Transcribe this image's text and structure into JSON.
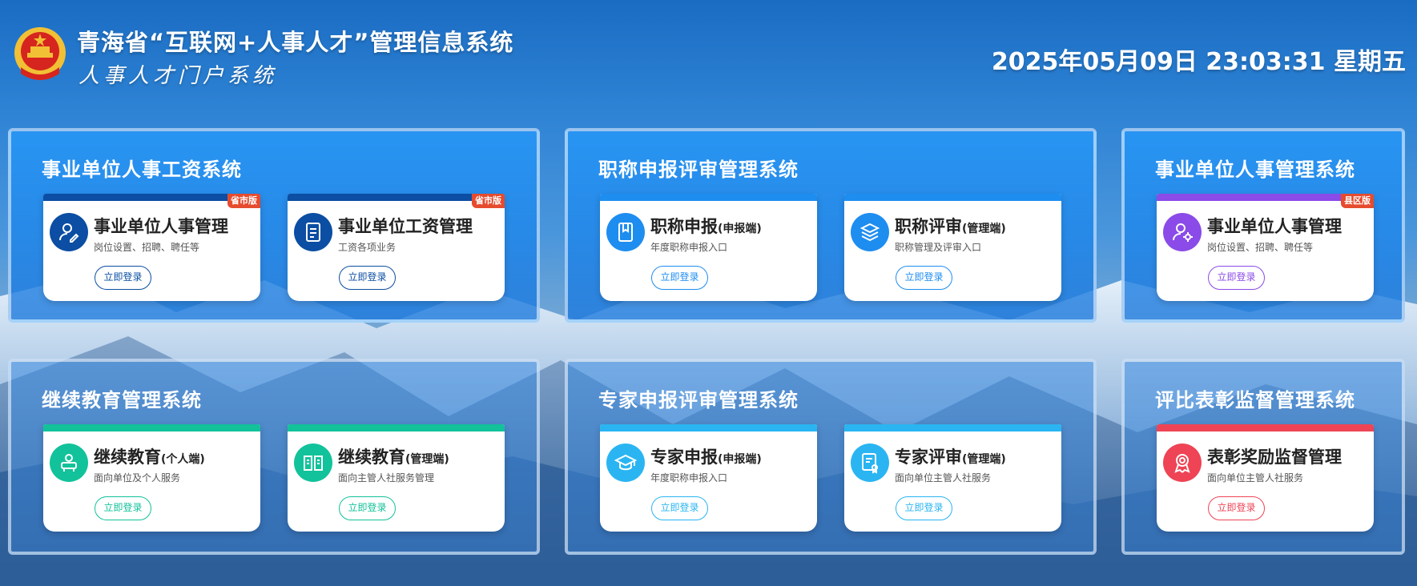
{
  "header": {
    "title": "青海省“互联网+人事人才”管理信息系统",
    "subtitle": "人事人才门户系统",
    "datetime": "2025年05月09日 23:03:31 星期五"
  },
  "colors": {
    "dark_blue": "#0b4ea3",
    "light_blue": "#1e8df0",
    "purple": "#8a4be8",
    "teal": "#12c29a",
    "sky": "#2ab5f2",
    "red": "#ee4455",
    "tag": "#e64b2e"
  },
  "panels": [
    {
      "title": "事业单位人事工资系统",
      "cards": [
        {
          "name": "事业单位人事管理",
          "suffix": "",
          "desc": "岗位设置、招聘、聘任等",
          "button": "立即登录",
          "tag": "省市版",
          "icon": "user-edit-icon"
        },
        {
          "name": "事业单位工资管理",
          "suffix": "",
          "desc": "工资各项业务",
          "button": "立即登录",
          "tag": "省市版",
          "icon": "document-list-icon"
        }
      ]
    },
    {
      "title": "职称申报评审管理系统",
      "cards": [
        {
          "name": "职称申报",
          "suffix": "(申报端)",
          "desc": "年度职称申报入口",
          "button": "立即登录",
          "tag": "",
          "icon": "book-icon"
        },
        {
          "name": "职称评审",
          "suffix": "(管理端)",
          "desc": "职称管理及评审入口",
          "button": "立即登录",
          "tag": "",
          "icon": "layers-icon"
        }
      ]
    },
    {
      "title": "事业单位人事管理系统",
      "cards": [
        {
          "name": "事业单位人事管理",
          "suffix": "",
          "desc": "岗位设置、招聘、聘任等",
          "button": "立即登录",
          "tag": "县区版",
          "icon": "user-gear-icon"
        }
      ]
    },
    {
      "title": "继续教育管理系统",
      "cards": [
        {
          "name": "继续教育",
          "suffix": "(个人端)",
          "desc": "面向单位及个人服务",
          "button": "立即登录",
          "tag": "",
          "icon": "person-board-icon"
        },
        {
          "name": "继续教育",
          "suffix": "(管理端)",
          "desc": "面向主管人社服务管理",
          "button": "立即登录",
          "tag": "",
          "icon": "open-book-icon"
        }
      ]
    },
    {
      "title": "专家申报评审管理系统",
      "cards": [
        {
          "name": "专家申报",
          "suffix": "(申报端)",
          "desc": "年度职称申报入口",
          "button": "立即登录",
          "tag": "",
          "icon": "graduation-cap-icon"
        },
        {
          "name": "专家评审",
          "suffix": "(管理端)",
          "desc": "面向单位主管人社服务",
          "button": "立即登录",
          "tag": "",
          "icon": "certificate-icon"
        }
      ]
    },
    {
      "title": "评比表彰监督管理系统",
      "cards": [
        {
          "name": "表彰奖励监督管理",
          "suffix": "",
          "desc": "面向单位主管人社服务",
          "button": "立即登录",
          "tag": "",
          "icon": "award-ribbon-icon"
        }
      ]
    }
  ]
}
